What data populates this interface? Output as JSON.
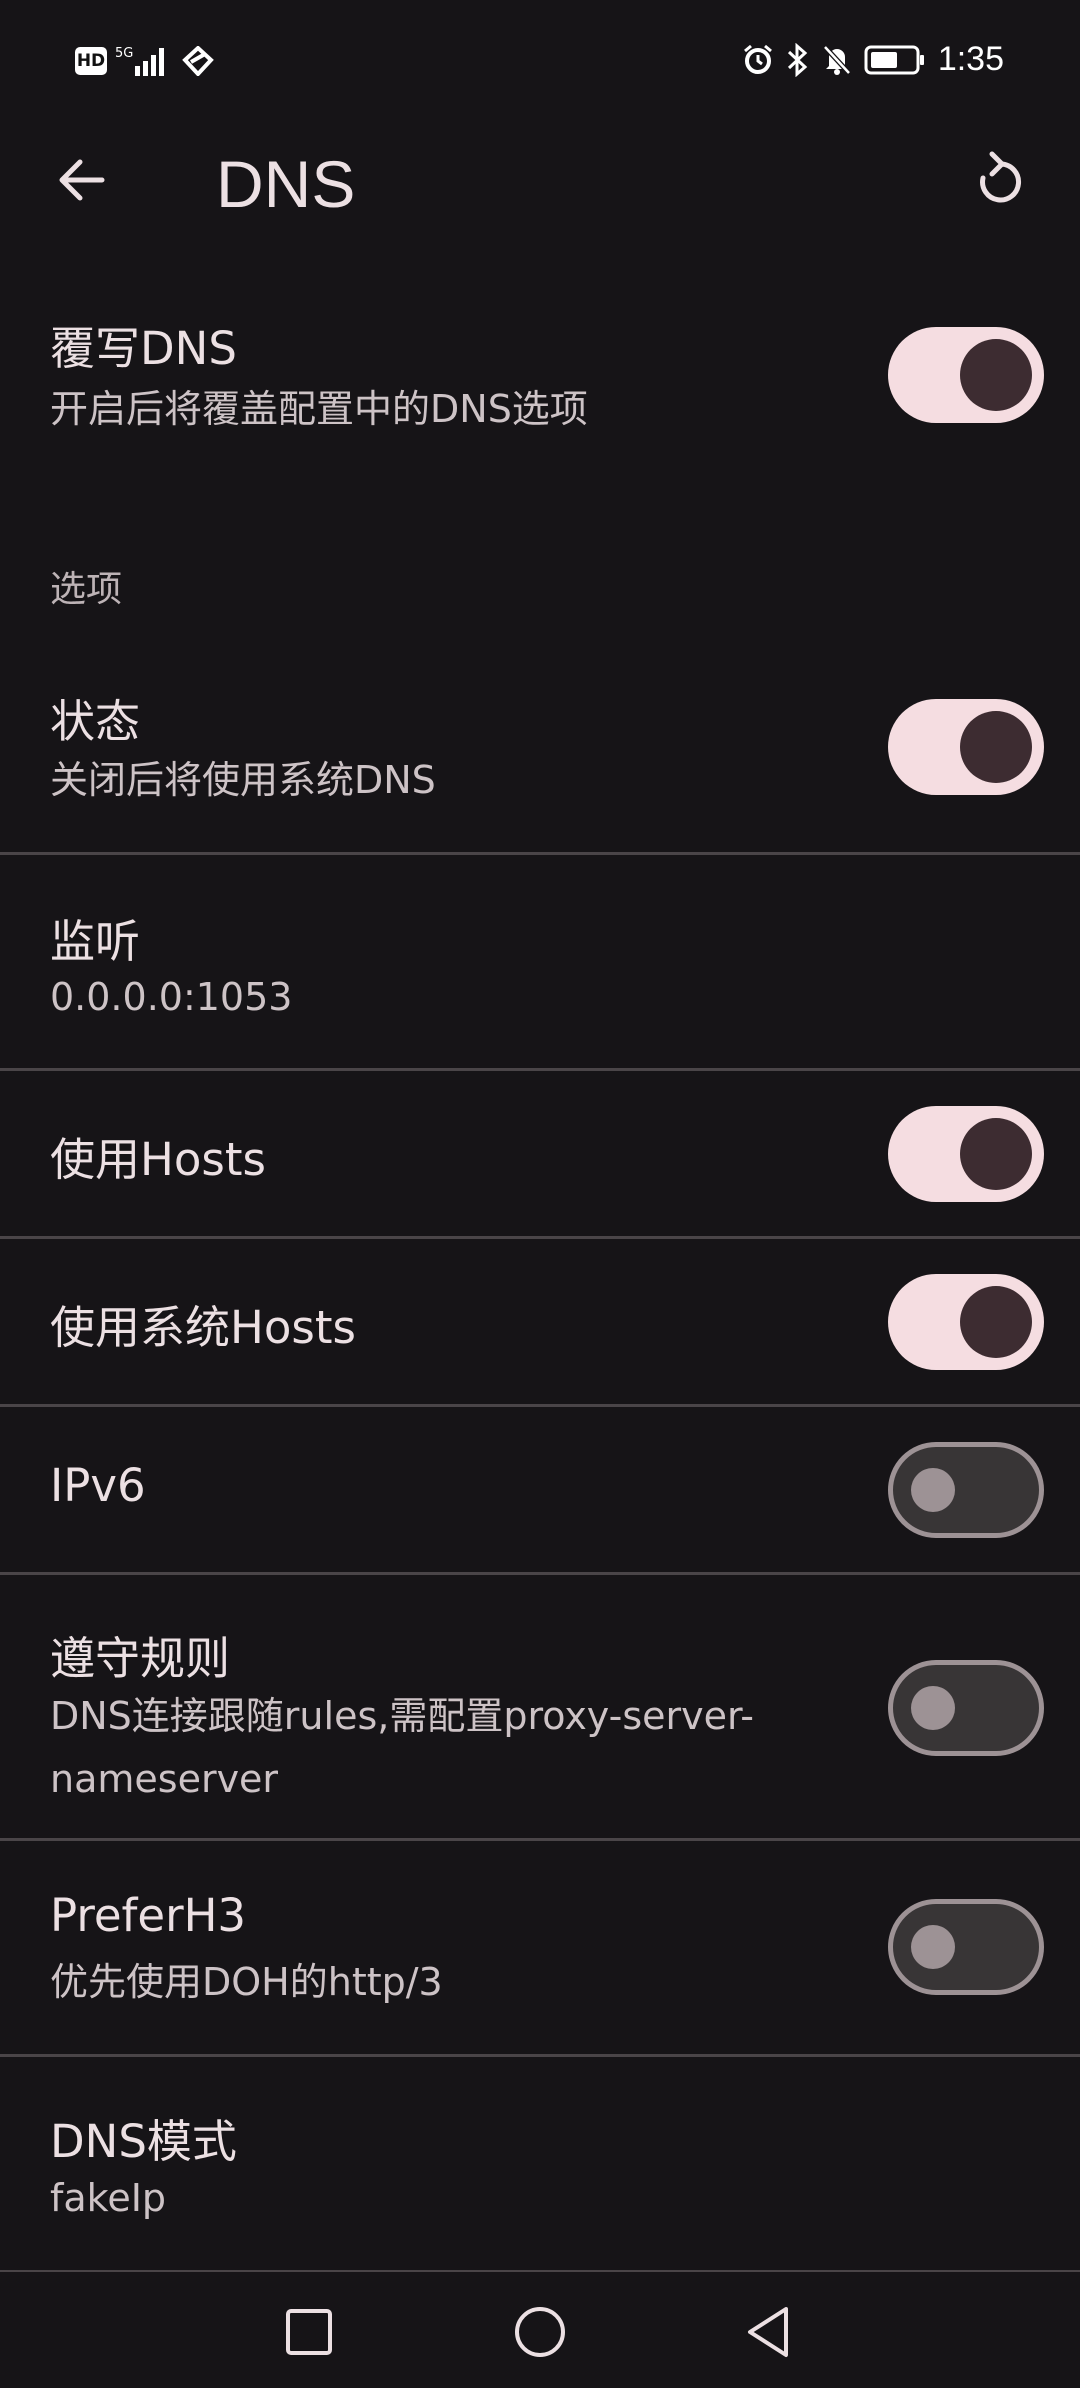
{
  "status_bar": {
    "hd_badge": "HD",
    "network": "5G",
    "time": "1:35",
    "icons": [
      "signal-icon",
      "wifi-icon",
      "alarm-icon",
      "bluetooth-icon",
      "bell-off-icon",
      "battery-icon"
    ]
  },
  "app_bar": {
    "title": "DNS",
    "back_icon": "arrow-left-icon",
    "reset_icon": "refresh-icon"
  },
  "settings": {
    "override": {
      "title": "覆写DNS",
      "subtitle": "开启后将覆盖配置中的DNS选项",
      "enabled": true
    },
    "section_label": "选项",
    "status": {
      "title": "状态",
      "subtitle": "关闭后将使用系统DNS",
      "enabled": true
    },
    "listen": {
      "title": "监听",
      "value": "0.0.0.0:1053"
    },
    "use_hosts": {
      "title": "使用Hosts",
      "enabled": true
    },
    "use_system_hosts": {
      "title": "使用系统Hosts",
      "enabled": true
    },
    "ipv6": {
      "title": "IPv6",
      "enabled": false
    },
    "respect_rules": {
      "title": "遵守规则",
      "subtitle_line1": "DNS连接跟随rules,需配置proxy-server-",
      "subtitle_line2": "nameserver",
      "enabled": false
    },
    "prefer_h3": {
      "title": "PreferH3",
      "subtitle": "优先使用DOH的http/3",
      "enabled": false
    },
    "dns_mode": {
      "title": "DNS模式",
      "value": "fakeIp"
    }
  },
  "nav_bar": {
    "icons": [
      "recent-apps-icon",
      "home-icon",
      "back-triangle-icon"
    ]
  },
  "colors": {
    "background": "#161417",
    "switch_on_track": "#f5dde1",
    "switch_on_thumb": "#3d2c31",
    "switch_off_track": "#383536",
    "switch_off_outline": "#9d9295",
    "divider": "#4a4548"
  }
}
